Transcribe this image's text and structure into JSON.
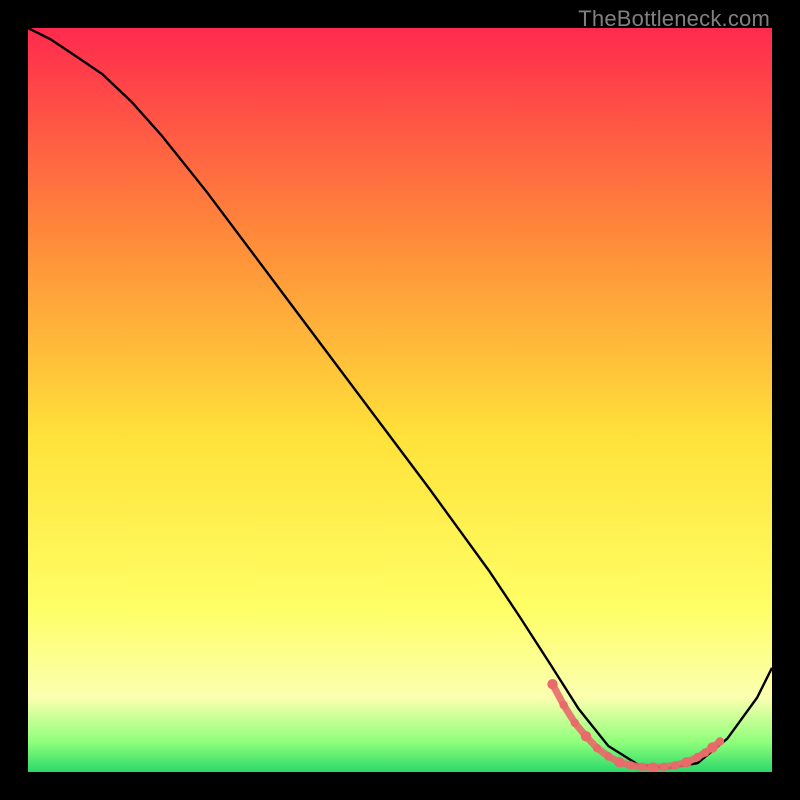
{
  "watermark": "TheBottleneck.com",
  "colors": {
    "gradient_top": "#ff2a4e",
    "gradient_mid1": "#ff8a3a",
    "gradient_mid2": "#ffe23a",
    "gradient_mid3": "#ffff66",
    "gradient_band": "#fbffb0",
    "gradient_green1": "#8eff7a",
    "gradient_green2": "#2bd86a",
    "curve": "#000000",
    "markers": "#e86a6a",
    "frame": "#000000"
  },
  "chart_data": {
    "type": "line",
    "title": "",
    "xlabel": "",
    "ylabel": "",
    "xlim": [
      0,
      100
    ],
    "ylim": [
      0,
      100
    ],
    "series": [
      {
        "name": "bottleneck-curve",
        "x": [
          0,
          3,
          6,
          10,
          14,
          18,
          24,
          30,
          36,
          42,
          48,
          54,
          58,
          62,
          66,
          70,
          74,
          78,
          82,
          86,
          90,
          94,
          98,
          100
        ],
        "y": [
          100,
          98.5,
          96.5,
          93.8,
          90,
          85.5,
          78,
          70,
          62,
          54,
          46,
          38,
          32.5,
          27,
          21,
          14.8,
          8.5,
          3.5,
          1,
          0.5,
          1.2,
          4.5,
          10,
          14
        ]
      }
    ],
    "markers": {
      "name": "sweet-spot",
      "x": [
        70.5,
        72,
        73.5,
        75,
        76.5,
        78,
        79.5,
        81,
        82.5,
        84,
        85.5,
        87,
        88.5,
        90,
        91,
        92,
        93
      ],
      "y": [
        11.8,
        9.0,
        6.6,
        4.8,
        3.2,
        2.1,
        1.3,
        0.9,
        0.7,
        0.6,
        0.7,
        0.9,
        1.3,
        2.0,
        2.6,
        3.3,
        4.1
      ]
    }
  }
}
